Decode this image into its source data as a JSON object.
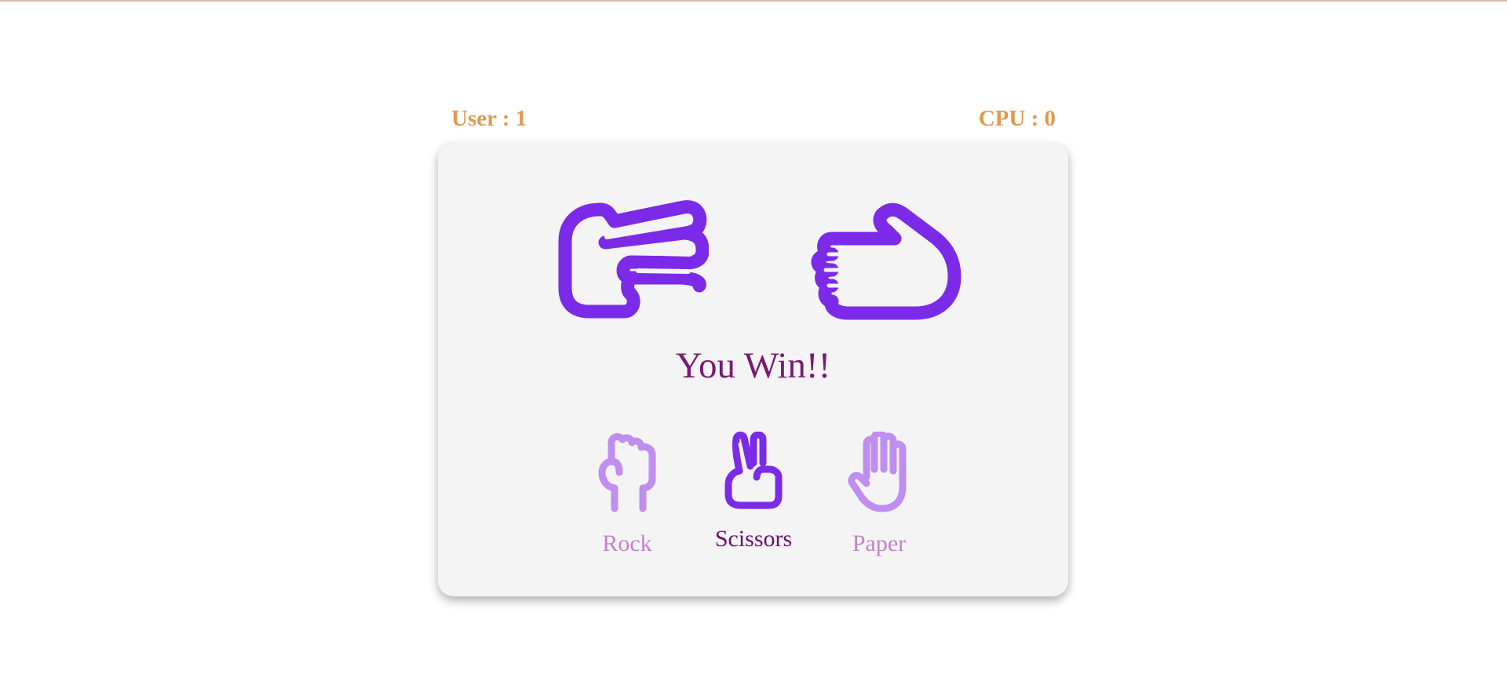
{
  "scores": {
    "user": "User : 1",
    "cpu": "CPU : 0"
  },
  "board": {
    "user_choice_icon": "scissors-hand-icon",
    "cpu_choice_icon": "paper-hand-icon",
    "result_text": "You Win!!"
  },
  "choices": [
    {
      "label": "Rock",
      "icon": "rock-hand-icon",
      "selected": false
    },
    {
      "label": "Scissors",
      "icon": "scissors-hand-icon",
      "selected": true
    },
    {
      "label": "Paper",
      "icon": "paper-hand-icon",
      "selected": false
    }
  ],
  "colors": {
    "accent": "#7b2ae8",
    "accent_faded": "#bf8ef0",
    "score": "#e09a4c",
    "result": "#7a1a72",
    "label_faded": "#c483c4",
    "label_selected": "#6a0f6a",
    "card": "#f4f4f5"
  }
}
